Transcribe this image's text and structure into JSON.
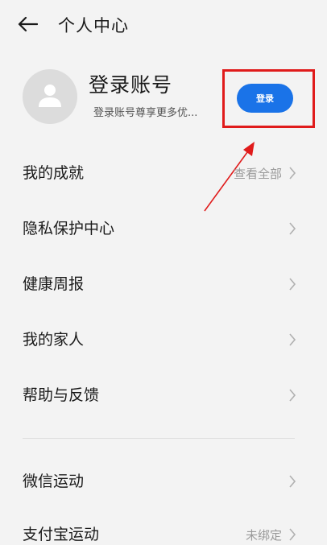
{
  "header": {
    "title": "个人中心"
  },
  "profile": {
    "title": "登录账号",
    "subtitle": "登录账号尊享更多优...",
    "login_label": "登录"
  },
  "menu": {
    "items": [
      {
        "label": "我的成就",
        "hint": "查看全部"
      },
      {
        "label": "隐私保护中心",
        "hint": ""
      },
      {
        "label": "健康周报",
        "hint": ""
      },
      {
        "label": "我的家人",
        "hint": ""
      },
      {
        "label": "帮助与反馈",
        "hint": ""
      },
      {
        "label": "微信运动",
        "hint": ""
      },
      {
        "label": "支付宝运动",
        "hint": "未绑定"
      }
    ]
  },
  "colors": {
    "accent": "#1a73e8",
    "highlight": "#e01b1b",
    "background": "#f3f3f3"
  },
  "icons": {
    "back": "arrow-left-icon",
    "avatar": "user-icon",
    "chevron": "chevron-right-icon"
  }
}
